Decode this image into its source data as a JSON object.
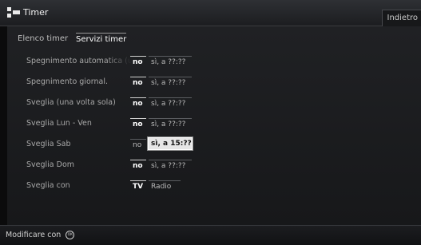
{
  "header": {
    "title": "Timer",
    "back_label": "Indietro",
    "icon": "timer-app-icon"
  },
  "tabs": [
    {
      "label": "Elenco timer",
      "active": false
    },
    {
      "label": "Servizi timer",
      "active": true
    }
  ],
  "rows": [
    {
      "label": "Spegnimento automatica (una",
      "options": [
        "no",
        "sì, a ??:??"
      ],
      "selected": "no"
    },
    {
      "label": "Spegnimento giornal.",
      "options": [
        "no",
        "sì, a ??:??"
      ],
      "selected": "no"
    },
    {
      "label": "Sveglia (una volta sola)",
      "options": [
        "no",
        "sì, a ??:??"
      ],
      "selected": "no"
    },
    {
      "label": "Sveglia Lun - Ven",
      "options": [
        "no",
        "sì, a ??:??"
      ],
      "selected": "no"
    },
    {
      "label": "Sveglia Sab",
      "options": [
        "no",
        "sì, a 15:??"
      ],
      "selected": "sì, a 15:??",
      "focused": "sì, a 15:??"
    },
    {
      "label": "Sveglia Dom",
      "options": [
        "no",
        "sì, a ??:??"
      ],
      "selected": "no"
    },
    {
      "label": "Sveglia con",
      "options": [
        "TV",
        "Radio"
      ],
      "selected": "TV"
    }
  ],
  "footer": {
    "text": "Modificare con",
    "icon": "ok-button-icon",
    "icon_text": "OK"
  }
}
